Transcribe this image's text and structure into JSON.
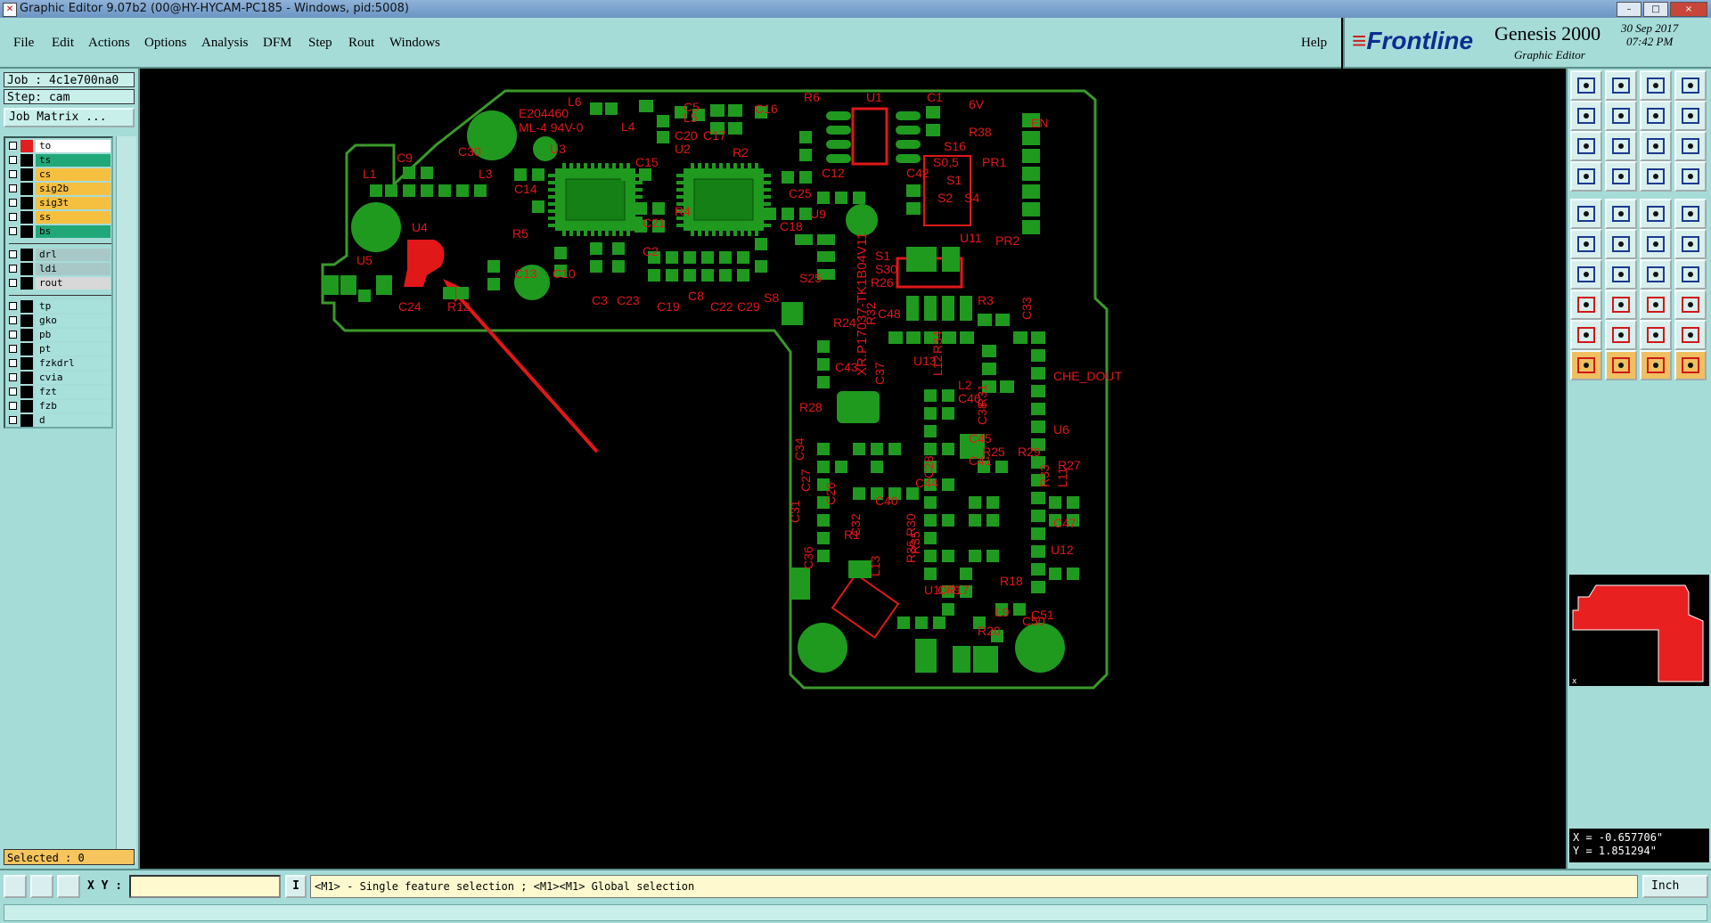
{
  "window": {
    "title": "Graphic Editor 9.07b2 (00@HY-HYCAM-PC185 - Windows, pid:5008)",
    "controls": [
      "–",
      "□",
      "×"
    ]
  },
  "menu": {
    "items": [
      "File",
      "Edit",
      "Actions",
      "Options",
      "Analysis",
      "DFM",
      "Step",
      "Rout",
      "Windows"
    ],
    "help": "Help"
  },
  "brand": {
    "logo": "Frontline",
    "product": "Genesis 2000",
    "subtitle": "Graphic Editor",
    "date": "30 Sep 2017",
    "time": "07:42 PM"
  },
  "job": {
    "job_label": "Job : 4c1e700na0",
    "step_label": "Step: cam",
    "matrix_button": "Job Matrix ..."
  },
  "layers": {
    "group1": [
      {
        "name": "to",
        "color": "#ffffff",
        "swatch": "#e02020",
        "active": true
      },
      {
        "name": "ts",
        "color": "#20a878",
        "swatch": "#000000"
      },
      {
        "name": "cs",
        "color": "#f5c040",
        "swatch": "#000000"
      },
      {
        "name": "sig2b",
        "color": "#f5c040",
        "swatch": "#000000"
      },
      {
        "name": "sig3t",
        "color": "#f5c040",
        "swatch": "#000000"
      },
      {
        "name": "ss",
        "color": "#f5c040",
        "swatch": "#000000"
      },
      {
        "name": "bs",
        "color": "#20a878",
        "swatch": "#000000"
      }
    ],
    "group2": [
      {
        "name": "drl",
        "color": "#a8c8c8",
        "swatch": "#000000"
      },
      {
        "name": "ldi",
        "color": "#a8c8c8",
        "swatch": "#000000"
      },
      {
        "name": "rout",
        "color": "#d8d8d8",
        "swatch": "#000000"
      }
    ],
    "group3": [
      {
        "name": "tp",
        "color": "#a8e0dc",
        "swatch": "#000000"
      },
      {
        "name": "gko",
        "color": "#a8e0dc",
        "swatch": "#000000"
      },
      {
        "name": "pb",
        "color": "#a8e0dc",
        "swatch": "#000000"
      },
      {
        "name": "pt",
        "color": "#a8e0dc",
        "swatch": "#000000"
      },
      {
        "name": "fzkdrl",
        "color": "#a8e0dc",
        "swatch": "#000000"
      },
      {
        "name": "cvia",
        "color": "#a8e0dc",
        "swatch": "#000000"
      },
      {
        "name": "fzt",
        "color": "#a8e0dc",
        "swatch": "#000000"
      },
      {
        "name": "fzb",
        "color": "#a8e0dc",
        "swatch": "#000000"
      },
      {
        "name": "d",
        "color": "#a8e0dc",
        "swatch": "#000000"
      }
    ]
  },
  "selection": {
    "label": "Selected : 0"
  },
  "board": {
    "text_lines": [
      "E204460",
      "ML-4 94V-0"
    ],
    "part_number": "XR.P17037-TK1B04V11",
    "designators": [
      "L6",
      "R6",
      "U1",
      "C1",
      "6V",
      "EN",
      "R38",
      "S16",
      "PR1",
      "S0,5",
      "S1",
      "S2",
      "S4",
      "U3",
      "U2",
      "C15",
      "C20",
      "C17",
      "C5",
      "C16",
      "R2",
      "C12",
      "L4",
      "L5",
      "L1",
      "C9",
      "C30",
      "L3",
      "C14",
      "C25",
      "U9",
      "C42",
      "C18",
      "R5",
      "R4",
      "C2",
      "C21",
      "U11",
      "PR2",
      "U4",
      "U5",
      "C24",
      "R12",
      "C13",
      "C10",
      "C3",
      "C23",
      "C19",
      "C8",
      "C22",
      "C29",
      "S8",
      "S25",
      "S1",
      "S30",
      "R26",
      "C48",
      "R32",
      "R3",
      "C33",
      "R24",
      "C43",
      "R34",
      "U13",
      "L12",
      "L2",
      "C37",
      "C46",
      "R31",
      "CHE_DOUT",
      "U6",
      "R28",
      "C38",
      "C45",
      "R25",
      "C41",
      "R29",
      "R27",
      "R33",
      "L11",
      "C34",
      "C27",
      "C26",
      "C40",
      "C44",
      "C28",
      "C31",
      "R1",
      "C32",
      "R30",
      "R35",
      "C47",
      "U12",
      "R36",
      "C36",
      "C49",
      "R18",
      "L13",
      "U10",
      "R17",
      "C50",
      "L9",
      "R20",
      "C51"
    ]
  },
  "coordinates": {
    "x": "X = -0.657706\"",
    "y": "Y = 1.851294\""
  },
  "status": {
    "xy_label": "X Y :",
    "xy_value": "",
    "message": "<M1> - Single feature selection ; <M1><M1> Global selection",
    "units": "Inch"
  },
  "colors": {
    "panel": "#a6dcd8",
    "board_green": "#1f9a1f",
    "silk_red": "#e01818",
    "outline": "#3a9a2a"
  }
}
